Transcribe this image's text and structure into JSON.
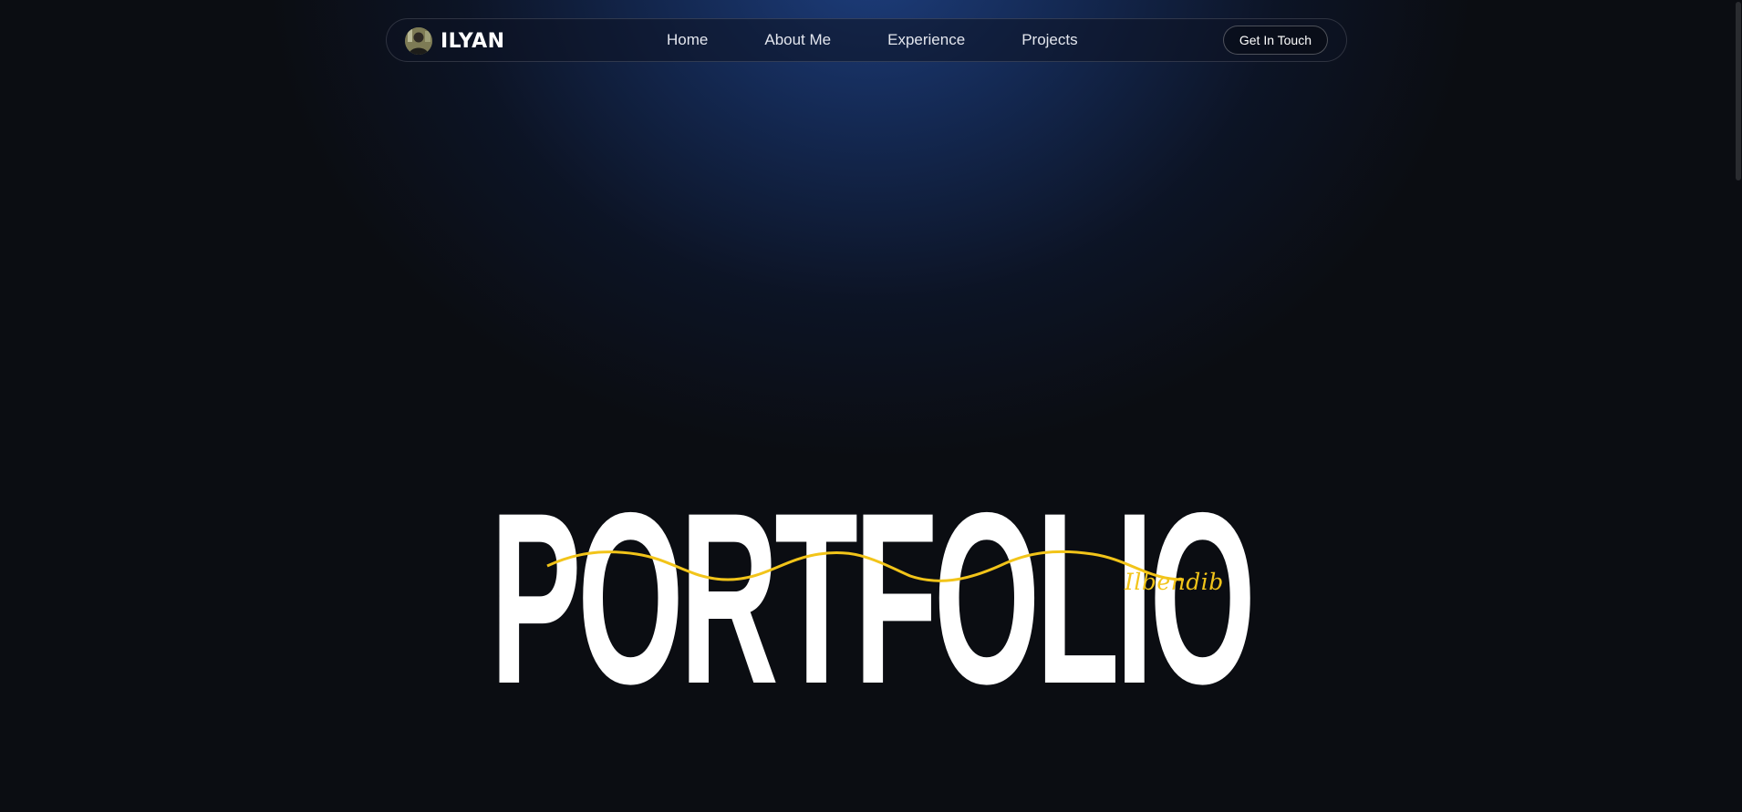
{
  "nav": {
    "brand": {
      "name": "ILYAN",
      "avatar_icon": "user-photo-icon"
    },
    "links": [
      {
        "label": "Home"
      },
      {
        "label": "About Me"
      },
      {
        "label": "Experience"
      },
      {
        "label": "Projects"
      }
    ],
    "cta_label": "Get In Touch"
  },
  "hero": {
    "title": "PORTFOLIO",
    "signature": "Ilbendib"
  },
  "colors": {
    "background": "#0b0d12",
    "glow": "#1e4082",
    "accent": "#f2c419",
    "text": "#ffffff"
  }
}
